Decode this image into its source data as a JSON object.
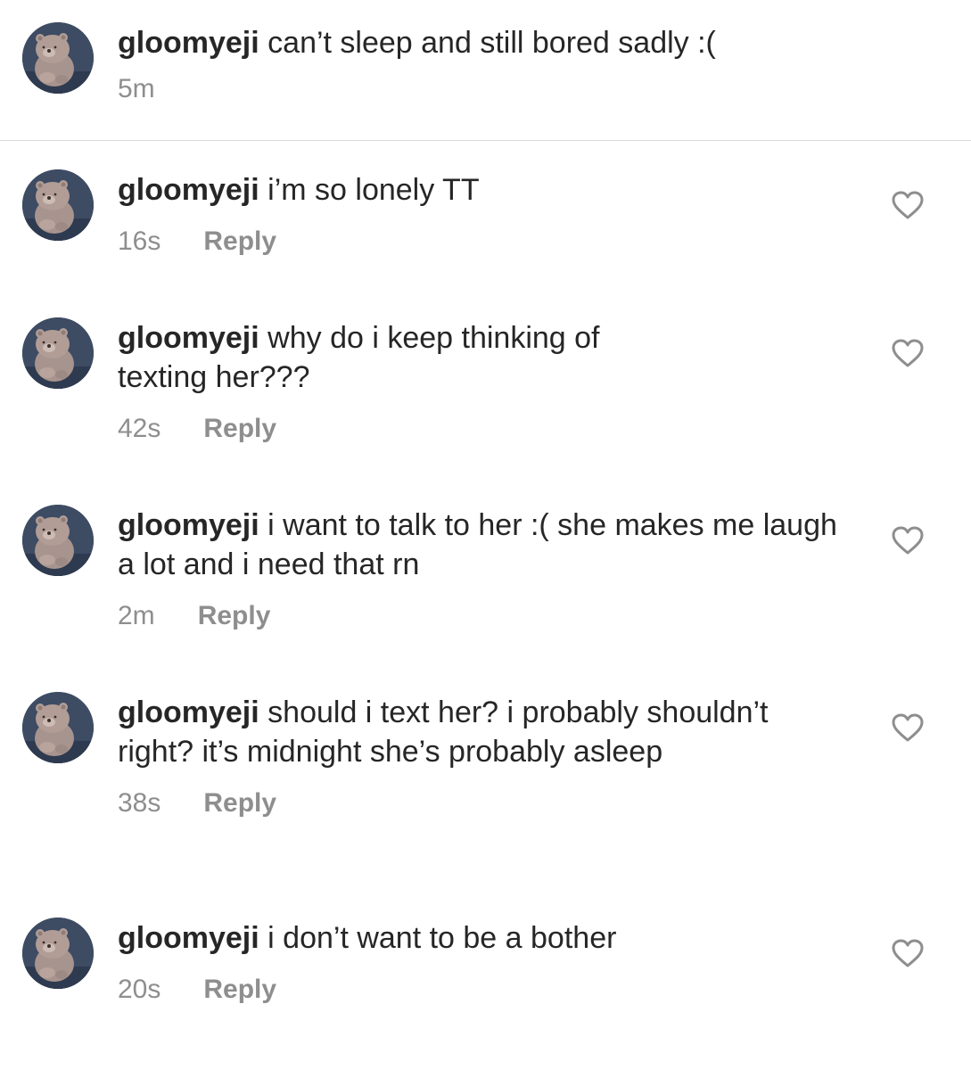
{
  "caption": {
    "username": "gloomyeji",
    "text": "can’t sleep and still bored sadly :(",
    "time": "5m"
  },
  "comments": [
    {
      "username": "gloomyeji",
      "text": "i’m so lonely TT",
      "time": "16s",
      "reply_label": "Reply"
    },
    {
      "username": "gloomyeji",
      "text": "why do i keep thinking of texting her???",
      "time": "42s",
      "reply_label": "Reply"
    },
    {
      "username": "gloomyeji",
      "text": "i want to talk to her :( she makes me laugh a lot and i need that rn",
      "time": "2m",
      "reply_label": "Reply"
    },
    {
      "username": "gloomyeji",
      "text": "should i text her? i probably shouldn’t right? it’s midnight she’s probably asleep",
      "time": "38s",
      "reply_label": "Reply"
    },
    {
      "username": "gloomyeji",
      "text": "i don’t want to be a bother",
      "time": "20s",
      "reply_label": "Reply"
    }
  ],
  "icons": {
    "avatar": "bear-avatar-icon",
    "like": "heart-outline-icon"
  },
  "colors": {
    "text": "#262626",
    "secondary": "#8e8e8e",
    "divider": "#dbdbdb"
  }
}
